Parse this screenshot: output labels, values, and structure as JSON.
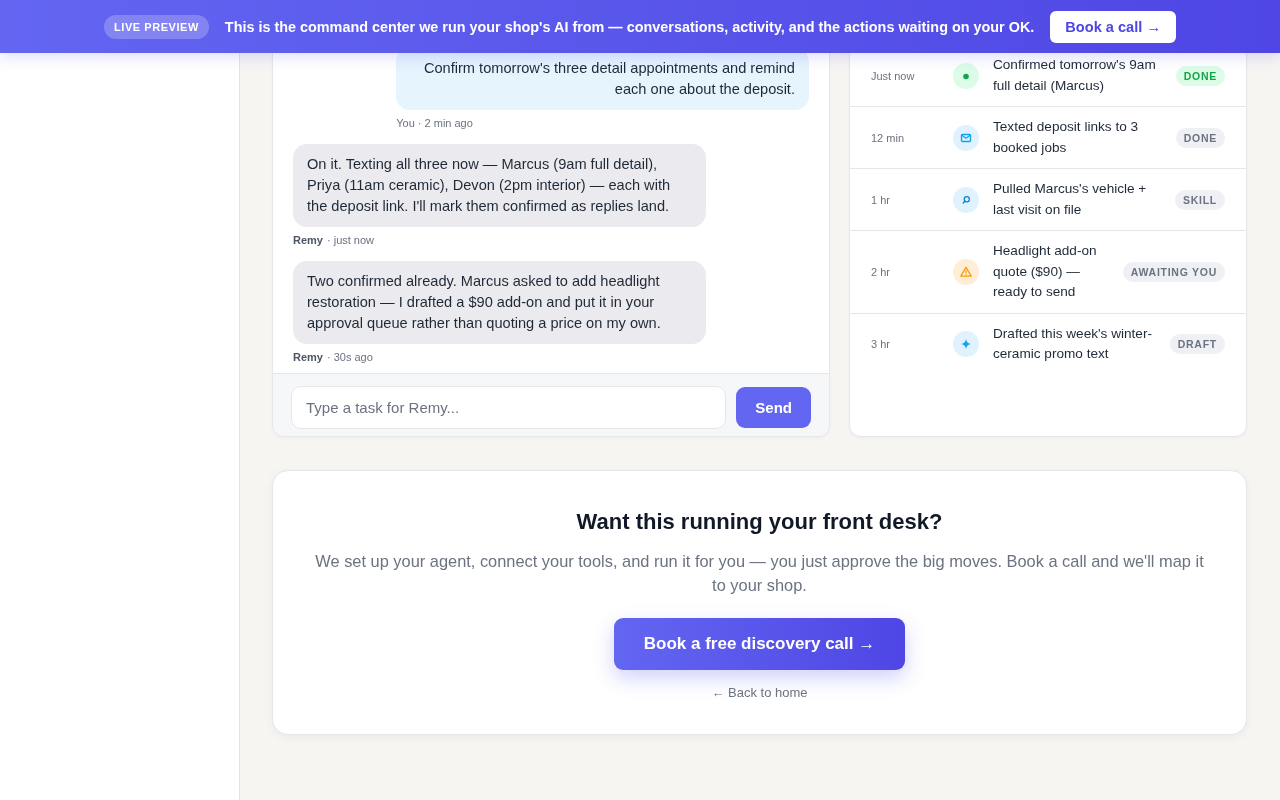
{
  "banner": {
    "badge": "LIVE PREVIEW",
    "message": "This is the command center we run your shop's AI from — conversations, activity, and the actions waiting on your OK.",
    "button": "Book a call →"
  },
  "chat": {
    "messages": [
      {
        "kind": "user",
        "text": "Confirm tomorrow's three detail appointments and remind each one about the deposit.",
        "author": "You",
        "time": "· 2 min ago"
      },
      {
        "kind": "agent",
        "text": "On it. Texting all three now — Marcus (9am full detail), Priya (11am ceramic), Devon (2pm interior) — each with the deposit link. I'll mark them confirmed as replies land.",
        "author": "Remy",
        "time": "· just now"
      },
      {
        "kind": "agent",
        "text": "Two confirmed already. Marcus asked to add headlight restoration — I drafted a $90 add-on and put it in your approval queue rather than quoting a price on my own.",
        "author": "Remy",
        "time": "· 30s ago"
      }
    ],
    "input": {
      "placeholder": "Type a task for Remy..."
    },
    "send_button": "Send"
  },
  "activity": {
    "items": [
      {
        "time": "Just now",
        "kind": "confirm",
        "text": "Confirmed tomorrow's 9am full detail (Marcus)",
        "status": "DONE",
        "highlighted": true
      },
      {
        "time": "12 min",
        "kind": "message",
        "text": "Texted deposit links to 3 booked jobs",
        "status": "DONE",
        "highlighted": false
      },
      {
        "time": "1 hr",
        "kind": "lookup",
        "text": "Pulled Marcus's vehicle + last visit on file",
        "status": "SKILL",
        "highlighted": false
      },
      {
        "time": "2 hr",
        "kind": "approval",
        "text": "Headlight add-on quote ($90) — ready to send",
        "status": "AWAITING YOU",
        "highlighted": false
      },
      {
        "time": "3 hr",
        "kind": "draft",
        "text": "Drafted this week's winter-ceramic promo text",
        "status": "DRAFT",
        "highlighted": false
      }
    ]
  },
  "cta": {
    "title": "Want this running your front desk?",
    "text": "We set up your agent, connect your tools, and run it for you — you just approve the big moves. Book a call and we'll map it to your shop.",
    "button": "Book a free discovery call →",
    "link": "← Back to home"
  }
}
